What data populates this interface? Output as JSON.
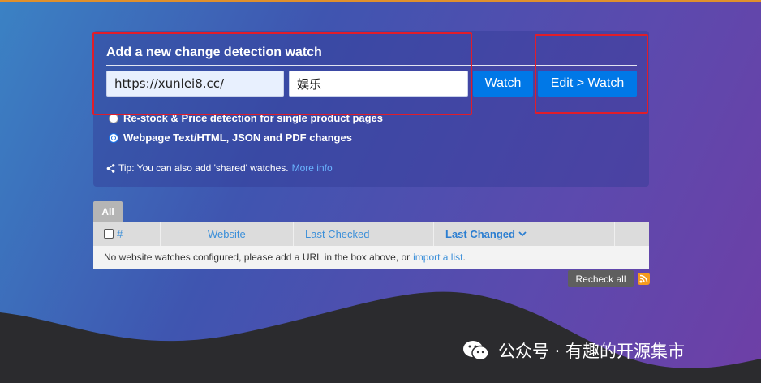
{
  "add_watch": {
    "title": "Add a new change detection watch",
    "url_value": "https://xunlei8.cc/",
    "tag_value": "娱乐",
    "watch_label": "Watch",
    "edit_watch_label": "Edit > Watch"
  },
  "processor_options": [
    {
      "label": "Re-stock & Price detection for single product pages",
      "selected": false
    },
    {
      "label": "Webpage Text/HTML, JSON and PDF changes",
      "selected": true
    }
  ],
  "tip": {
    "text": "Tip: You can also add 'shared' watches.",
    "link": "More info",
    "icon": "share-icon"
  },
  "tabs": [
    {
      "label": "All"
    }
  ],
  "table": {
    "columns": [
      "#",
      "",
      "Website",
      "Last Checked",
      "Last Changed",
      ""
    ],
    "sorted_column": "Last Changed",
    "empty_message": "No website watches configured, please add a URL in the box above, or",
    "empty_link": "import a list",
    "empty_suffix": "."
  },
  "recheck_all_label": "Recheck all",
  "rss_icon": "rss-icon",
  "watermark": {
    "text": "公众号 · 有趣的开源集市",
    "icon": "wechat-icon"
  },
  "colors": {
    "accent": "#0078e7",
    "highlight": "#e11d2a",
    "top_strip": "#e0902c"
  }
}
